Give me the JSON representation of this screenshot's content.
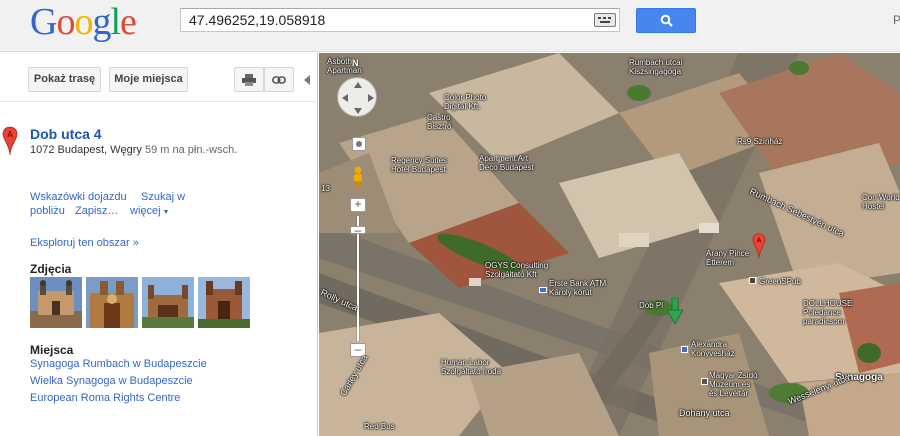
{
  "header": {
    "logo_letters": [
      "G",
      "o",
      "o",
      "g",
      "l",
      "e"
    ],
    "logo_colors": [
      "#3366cc",
      "#dd4b39",
      "#f4b400",
      "#3366cc",
      "#0f9d58",
      "#dd4b39"
    ],
    "search_value": "47.496252,19.058918",
    "right_edge_text": "P"
  },
  "toolbar": {
    "directions_label": "Pokaż trasę",
    "my_places_label": "Moje miejsca"
  },
  "place": {
    "marker_letter": "A",
    "title": "Dob utca 4",
    "address": "1072 Budapest, Węgry",
    "distance": "59 m na płn.-wsch."
  },
  "actions": {
    "directions": "Wskazówki dojazdu",
    "search_near_1": "Szukaj w",
    "search_near_2": "pobliżu",
    "save": "Zapisz…",
    "more": "więcej",
    "explore": "Eksploruj ten obszar »"
  },
  "photos": {
    "title": "Zdjęcia"
  },
  "places": {
    "title": "Miejsca",
    "items": [
      "Synagoga Rumbach w Budapeszcie",
      "Wielka Synagoga w Budapeszcie",
      "European Roma Rights Centre"
    ]
  },
  "map": {
    "north": "N",
    "labels": {
      "asboth": "Asboth",
      "apartman": "Apartman",
      "rumbach_kiosk_1": "Rumbach utcai",
      "rumbach_kiosk_2": "Kiszsingagóga",
      "colorphoto_1": "Color Photo",
      "colorphoto_2": "Digital Kft.",
      "castro_1": "Castro",
      "castro_2": "Bisztró",
      "regency_1": "Regency Suites",
      "regency_2": "Hotel Budapest",
      "apartment_art_1": "Apartment Art",
      "apartment_art_2": "Deco Budapest",
      "rs9": "Rs9 Színház",
      "rumbach_sebestyen": "Rumbach Sebestyén utca",
      "con_world_1": "Con World",
      "con_world_2": "Hostel",
      "ogys_1": "OGYS Consulting",
      "ogys_2": "Szolgáltató Kft",
      "erste_1": "Erste Bank ATM",
      "erste_2": "Károly körút",
      "arany_1": "Arany Pince",
      "arany_2": "Étterem",
      "greenspub": "GreenSPub",
      "dollhouse_1": "DOLLHOUSE",
      "dollhouse_2": "Poledance",
      "dollhouse_3": "paradicsom",
      "dob_pl": "Dob Pl",
      "alexandra_1": "Alexandra",
      "alexandra_2": "Könyvesház",
      "human_1": "Human Labor",
      "human_2": "Szolgáltató Iroda",
      "magyar_1": "Magyar Zsidó",
      "magyar_2": "Múzeum és",
      "magyar_3": "és Levéltár",
      "synagoga": "Synagoga",
      "wesselenyi": "Wesselényi utca",
      "dohany": "Dohány utca",
      "red_bus": "Red Bus",
      "carley": "Carley utca",
      "rolly": "Rolly utca",
      "num13": "13"
    }
  }
}
